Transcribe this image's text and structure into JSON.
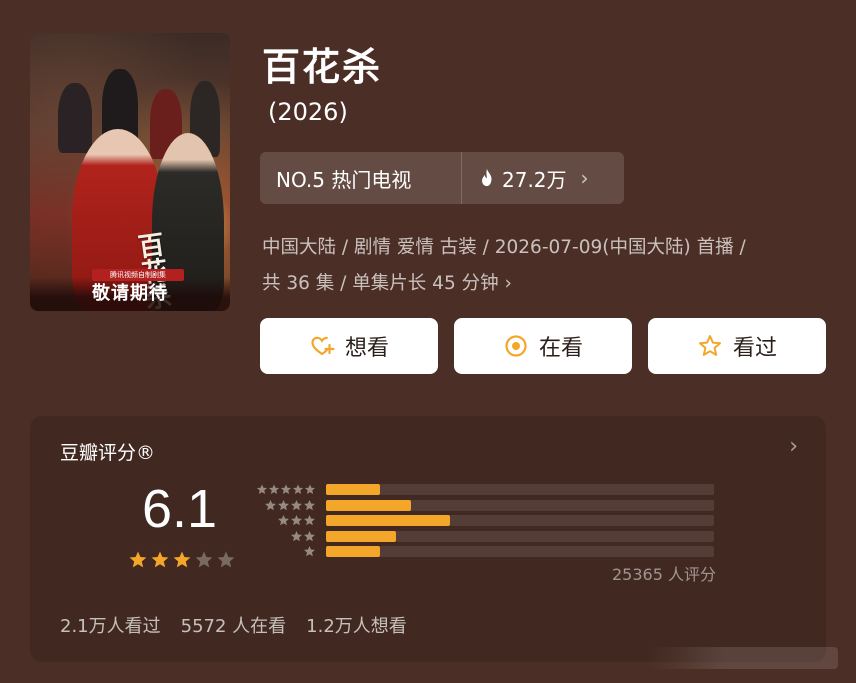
{
  "poster": {
    "title_art": "百花杀",
    "badge_text": "腾讯视频自制剧集",
    "cta": "敬请期待"
  },
  "title": "百花杀",
  "year": "(2026)",
  "ranking": {
    "label": "NO.5 热门电视",
    "heat": "27.2万",
    "chevron": "›"
  },
  "meta": {
    "line1": "中国大陆 / 剧情 爱情 古装 / 2026-07-09(中国大陆) 首播 /",
    "line2": "共 36 集 / 单集片长 45 分钟",
    "chevron": "›"
  },
  "actions": [
    {
      "label": "想看",
      "icon": "heart-plus-icon"
    },
    {
      "label": "在看",
      "icon": "target-icon"
    },
    {
      "label": "看过",
      "icon": "star-outline-icon"
    }
  ],
  "rating": {
    "title": "豆瓣评分®",
    "chevron": "›",
    "score": "6.1",
    "stars_filled": 3,
    "stars_total": 5,
    "distribution": [
      {
        "stars": 5,
        "fraction": 0.14
      },
      {
        "stars": 4,
        "fraction": 0.22
      },
      {
        "stars": 3,
        "fraction": 0.32
      },
      {
        "stars": 2,
        "fraction": 0.18
      },
      {
        "stars": 1,
        "fraction": 0.14
      }
    ],
    "count_text": "25365 人评分"
  },
  "stats": {
    "watched": "2.1万人看过",
    "watching": "5572 人在看",
    "want": "1.2万人想看"
  },
  "colors": {
    "background": "#4b2e25",
    "accent": "#f4a62a"
  }
}
